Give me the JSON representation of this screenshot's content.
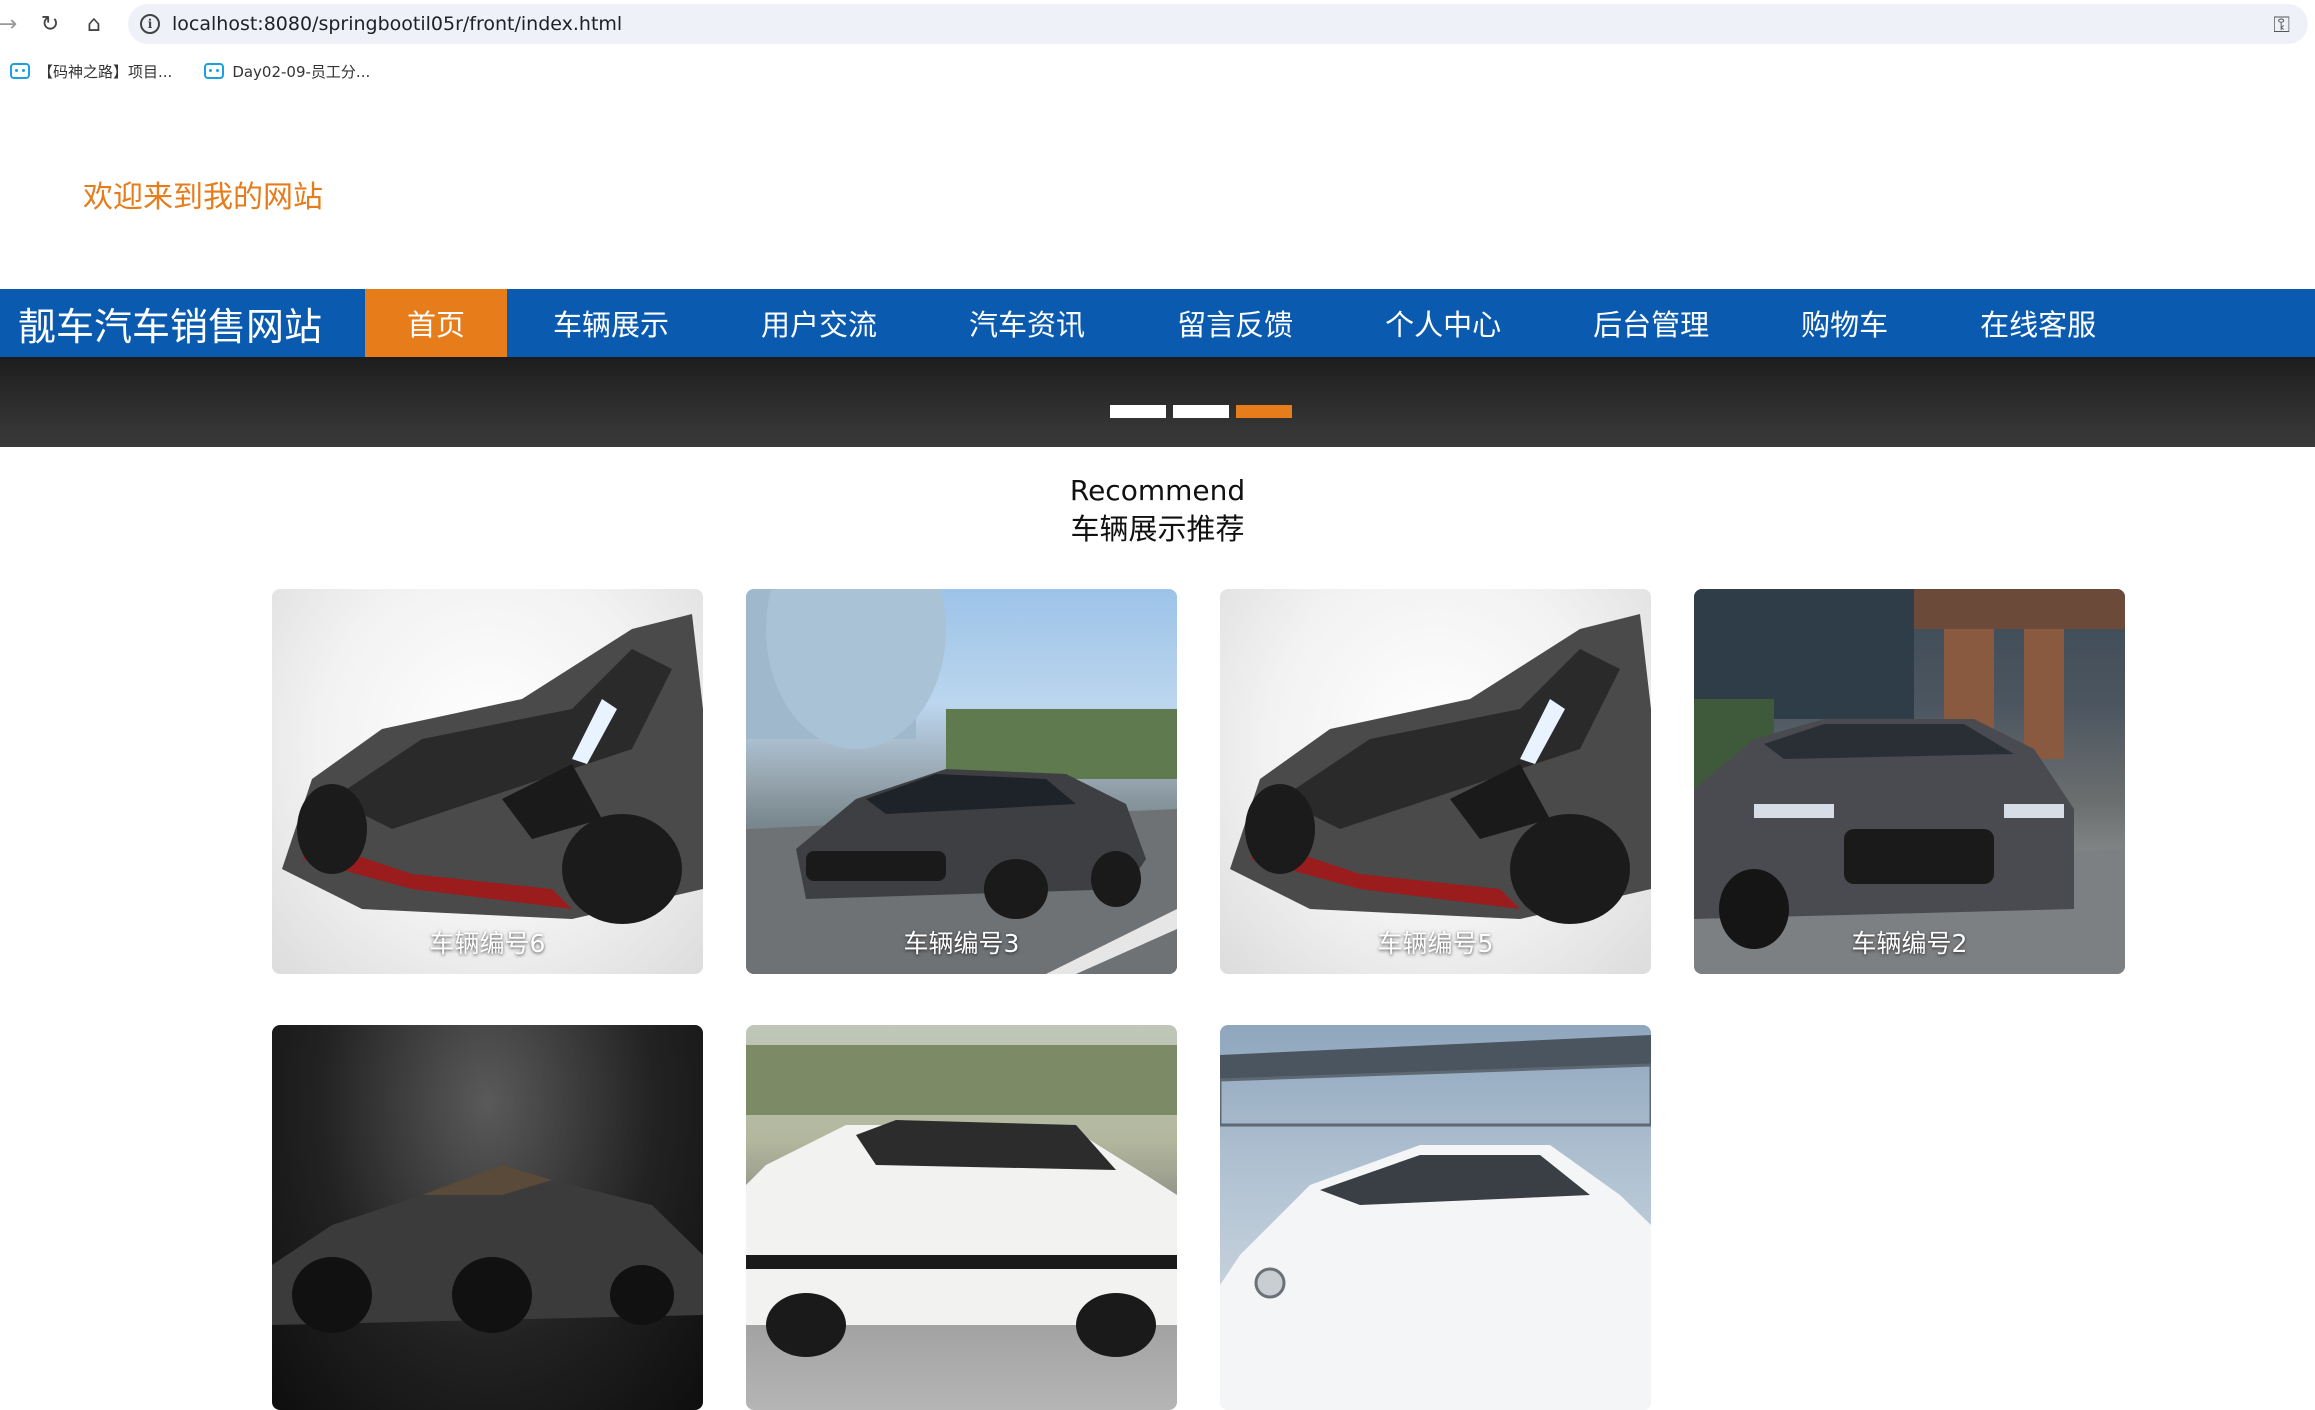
{
  "browser": {
    "url": "localhost:8080/springbootil05r/front/index.html",
    "bookmarks": [
      {
        "label": "【码神之路】项目..."
      },
      {
        "label": "Day02-09-员工分..."
      }
    ]
  },
  "header": {
    "welcome": "欢迎来到我的网站"
  },
  "nav": {
    "site_title": "靓车汽车销售网站",
    "items": [
      {
        "label": "首页",
        "active": true
      },
      {
        "label": "车辆展示"
      },
      {
        "label": "用户交流"
      },
      {
        "label": "汽车资讯"
      },
      {
        "label": "留言反馈"
      },
      {
        "label": "个人中心"
      },
      {
        "label": "后台管理"
      },
      {
        "label": "购物车"
      },
      {
        "label": "在线客服"
      }
    ]
  },
  "banner": {
    "slides": 3,
    "active_slide": 3
  },
  "section": {
    "title_en": "Recommend",
    "title_zh": "车辆展示推荐"
  },
  "cards": [
    {
      "label": "车辆编号6",
      "image": "gray-supercar-front"
    },
    {
      "label": "车辆编号3",
      "image": "gray-sedan-city-road"
    },
    {
      "label": "车辆编号5",
      "image": "gray-supercar-front"
    },
    {
      "label": "车辆编号2",
      "image": "gray-sedan-building"
    },
    {
      "label": "",
      "image": "dark-concept-roadster"
    },
    {
      "label": "",
      "image": "white-hatchback-track"
    },
    {
      "label": "",
      "image": "white-sedan-bridge"
    }
  ],
  "colors": {
    "nav_bg": "#0a5bb0",
    "accent": "#e77c1b"
  }
}
